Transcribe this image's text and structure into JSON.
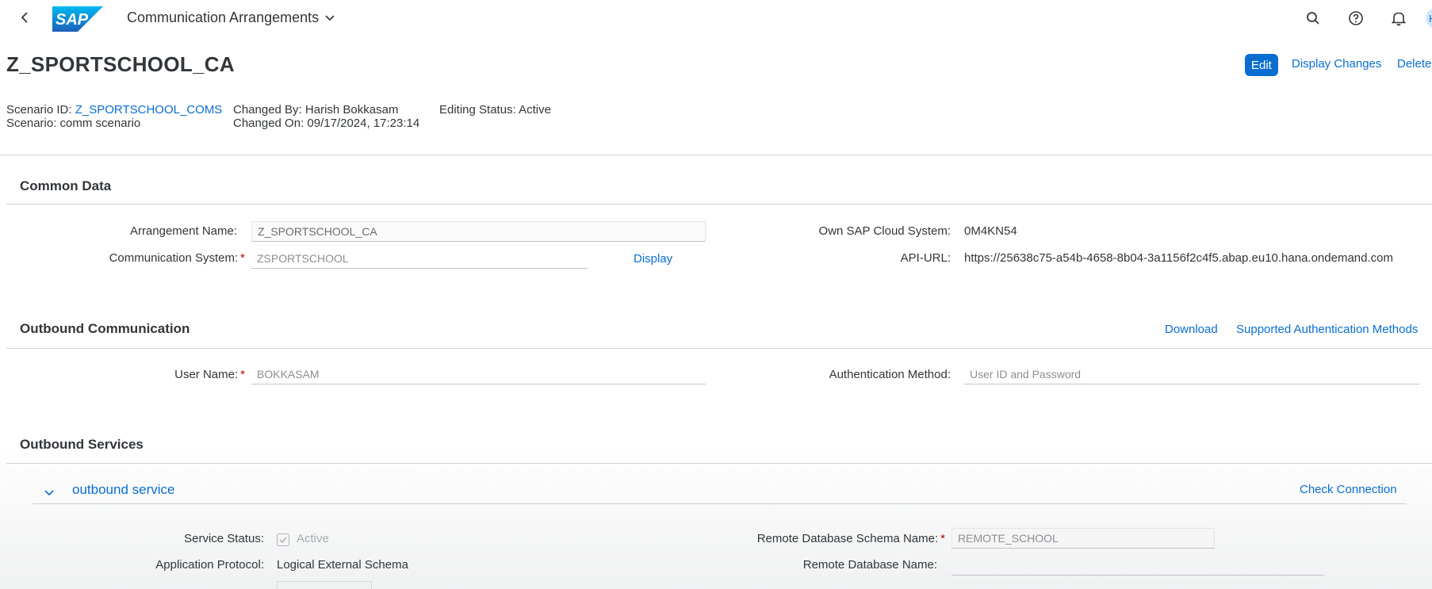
{
  "shell": {
    "app_title": "Communication Arrangements",
    "logo_text": "SAP",
    "avatar_initial": "H",
    "icons": [
      "back-icon",
      "search-icon",
      "help-icon",
      "bell-icon"
    ]
  },
  "header": {
    "title": "Z_SPORTSCHOOL_CA",
    "actions": {
      "edit": "Edit",
      "display_changes": "Display Changes",
      "delete": "Delete"
    },
    "scenario_id_label": "Scenario ID:",
    "scenario_id_value": "Z_SPORTSCHOOL_COMS",
    "scenario_label": "Scenario:",
    "scenario_value": "comm scenario",
    "changed_by_label": "Changed By:",
    "changed_by_value": "Harish Bokkasam",
    "changed_on_label": "Changed On:",
    "changed_on_value": "09/17/2024, 17:23:14",
    "editing_status_label": "Editing Status:",
    "editing_status_value": "Active"
  },
  "common_data": {
    "title": "Common Data",
    "arrangement_name_label": "Arrangement Name:",
    "arrangement_name_value": "Z_SPORTSCHOOL_CA",
    "communication_system_label": "Communication System:",
    "communication_system_value": "ZSPORTSCHOOL",
    "display_link": "Display",
    "own_system_label": "Own SAP Cloud System:",
    "own_system_value": "0M4KN54",
    "api_url_label": "API-URL:",
    "api_url_value": "https://25638c75-a54b-4658-8b04-3a1156f2c4f5.abap.eu10.hana.ondemand.com"
  },
  "outbound_communication": {
    "title": "Outbound Communication",
    "download_link": "Download",
    "auth_methods_link": "Supported Authentication Methods",
    "user_name_label": "User Name:",
    "user_name_value": "BOKKASAM",
    "auth_method_label": "Authentication Method:",
    "auth_method_value": "User ID and Password"
  },
  "outbound_services": {
    "title": "Outbound Services",
    "service_title": "outbound service",
    "check_connection_link": "Check Connection",
    "service_status_label": "Service Status:",
    "service_status_value": "Active",
    "app_protocol_label": "Application Protocol:",
    "app_protocol_value": "Logical External Schema",
    "remote_schema_label": "Remote Database Schema Name:",
    "remote_schema_value": "REMOTE_SCHOOL",
    "remote_db_label": "Remote Database Name:",
    "remote_db_value": ""
  },
  "colors": {
    "brand_blue": "#0a6ed1",
    "required_red": "#bb0000"
  }
}
